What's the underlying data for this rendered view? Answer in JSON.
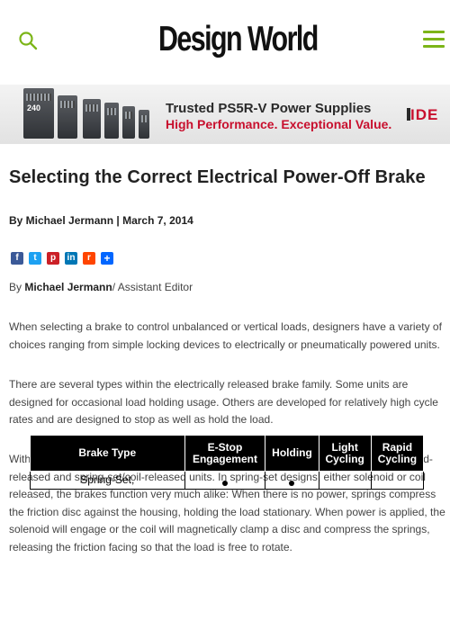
{
  "header": {
    "logo": "Design World",
    "accent_color": "#7cb518"
  },
  "banner": {
    "product_label": "240",
    "title": "Trusted PS5R-V Power Supplies",
    "subtitle": "High Performance. Exceptional Value.",
    "brand": "IDE",
    "subtitle_color": "#c8102e"
  },
  "article": {
    "title": "Selecting the Correct Electrical Power-Off Brake",
    "byline": "By Michael Jermann | March 7, 2014",
    "share_icons": [
      "facebook-icon",
      "twitter-icon",
      "pinterest-icon",
      "linkedin-icon",
      "reddit-icon",
      "share-plus-icon"
    ],
    "author_prefix": "By ",
    "author_name": "Michael Jermann",
    "author_role": "/ Assistant Editor",
    "paragraphs": [
      "When selecting a brake to control unbalanced or vertical loads, designers have a variety of choices ranging from simple locking devices to electrically or pneumatically powered units.",
      "There are several types within the electrically released brake family. Some units are designed for occasional load holding usage. Others are developed for relatively high cycle rates and are designed to stop as well as hold the load.",
      "Within the families of holding brakes there are two common designs: spring-set/solenoid-released and spring-set/coil-released units. In spring-set designs, either solenoid or coil released, the brakes function very much alike: When there is no power, springs compress the friction disc against the housing, holding the load stationary. When power is applied, the solenoid will engage or the coil will magnetically clamp a disc and compress the springs, releasing the friction facing so that the load is free to rotate."
    ]
  },
  "table": {
    "headers": [
      "Brake Type",
      "E-Stop Engagement",
      "Holding",
      "Light Cycling",
      "Rapid Cycling"
    ],
    "header_lines": [
      [
        "Brake Type"
      ],
      [
        "E-Stop",
        "Engagement"
      ],
      [
        "Holding"
      ],
      [
        "Light",
        "Cycling"
      ],
      [
        "Rapid",
        "Cycling"
      ]
    ],
    "rows": [
      {
        "type": "Spring-Set,",
        "marks": [
          true,
          true,
          false,
          false
        ]
      }
    ]
  }
}
